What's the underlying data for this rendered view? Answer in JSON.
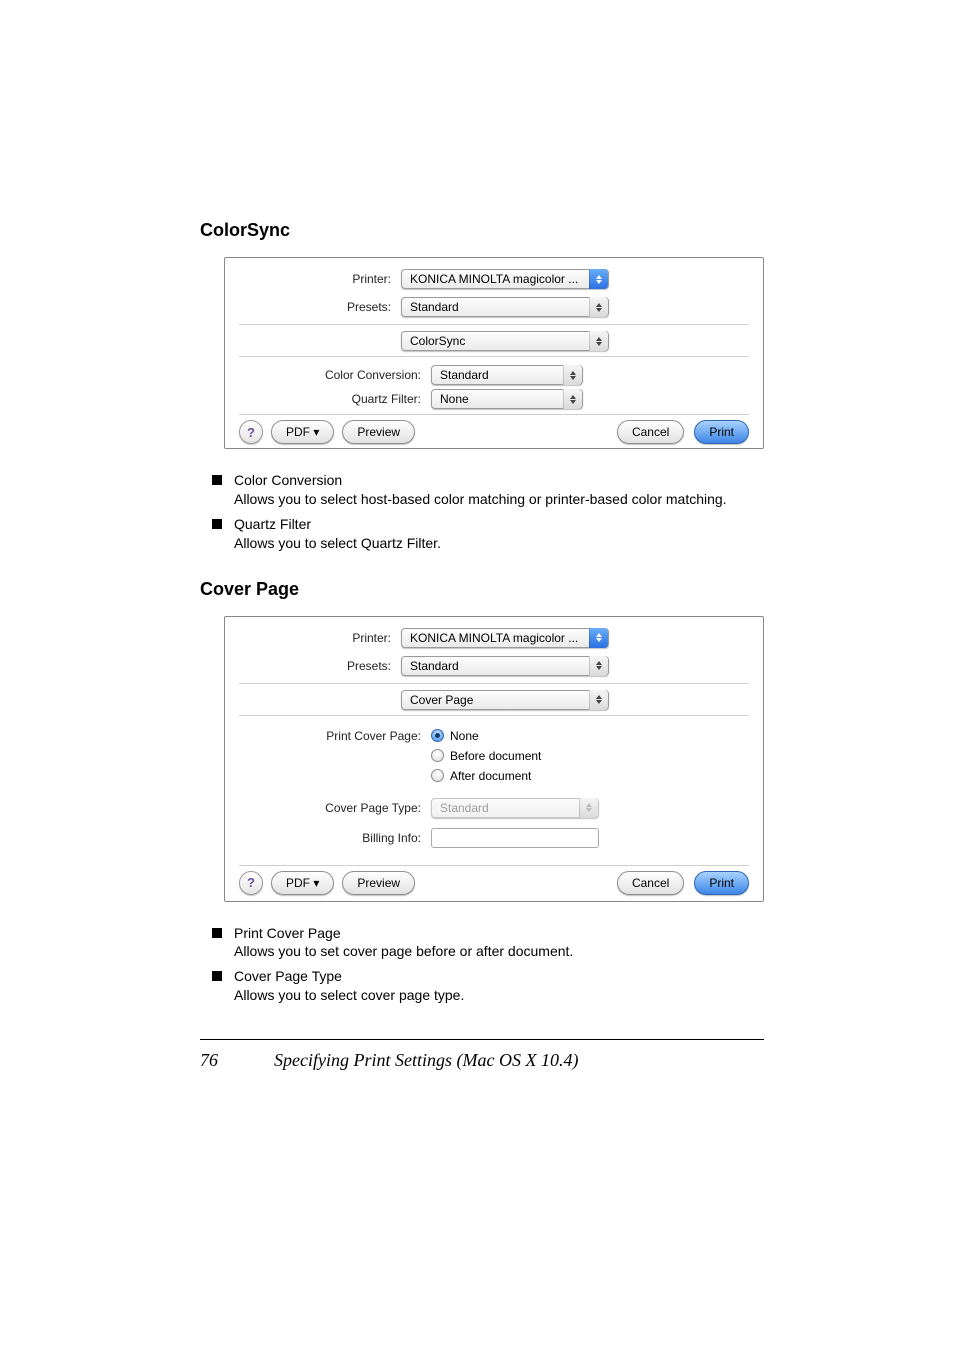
{
  "page": {
    "number": "76",
    "section_title": "Specifying Print Settings (Mac OS X 10.4)"
  },
  "section1": {
    "title": "ColorSync",
    "printer_label": "Printer:",
    "printer_value": "KONICA MINOLTA magicolor ...",
    "presets_label": "Presets:",
    "presets_value": "Standard",
    "pane_value": "ColorSync",
    "color_conversion_label": "Color Conversion:",
    "color_conversion_value": "Standard",
    "quartz_filter_label": "Quartz Filter:",
    "quartz_filter_value": "None",
    "help_label": "?",
    "pdf_label": "PDF ▾",
    "preview_label": "Preview",
    "cancel_label": "Cancel",
    "print_label": "Print",
    "bullets": [
      {
        "title": "Color Conversion",
        "desc": "Allows you to select host-based color matching or printer-based color matching."
      },
      {
        "title": "Quartz Filter",
        "desc": "Allows you to select Quartz Filter."
      }
    ]
  },
  "section2": {
    "title": "Cover Page",
    "printer_label": "Printer:",
    "printer_value": "KONICA MINOLTA magicolor ...",
    "presets_label": "Presets:",
    "presets_value": "Standard",
    "pane_value": "Cover Page",
    "print_cover_page_label": "Print Cover Page:",
    "radio_none": "None",
    "radio_before": "Before document",
    "radio_after": "After document",
    "cover_page_type_label": "Cover Page Type:",
    "cover_page_type_value": "Standard",
    "billing_info_label": "Billing Info:",
    "billing_info_value": "",
    "help_label": "?",
    "pdf_label": "PDF ▾",
    "preview_label": "Preview",
    "cancel_label": "Cancel",
    "print_label": "Print",
    "bullets": [
      {
        "title": "Print Cover Page",
        "desc": "Allows you to set cover page before or after document."
      },
      {
        "title": "Cover Page Type",
        "desc": "Allows you to select cover page type."
      }
    ]
  }
}
